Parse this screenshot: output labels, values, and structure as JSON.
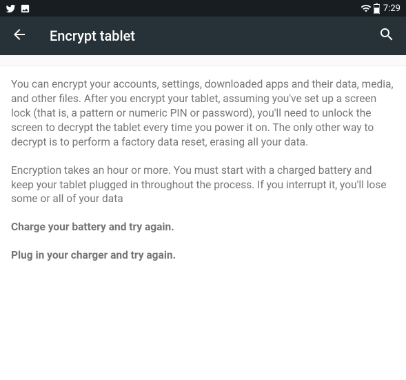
{
  "statusBar": {
    "time": "7:29"
  },
  "appBar": {
    "title": "Encrypt tablet"
  },
  "content": {
    "paragraph1": "You can encrypt your accounts, settings, downloaded apps and their data, media, and other files. After you encrypt your tablet, assuming you've set up a screen lock (that is, a pattern or numeric PIN or password), you'll need to unlock the screen to decrypt the tablet every time you power it on. The only other way to decrypt is to perform a factory data reset, erasing all your data.",
    "paragraph2": "Encryption takes an hour or more. You must start with a charged battery and keep your tablet plugged in throughout the process. If you interrupt it, you'll lose some or all of your data",
    "warning1": "Charge your battery and try again.",
    "warning2": "Plug in your charger and try again."
  }
}
